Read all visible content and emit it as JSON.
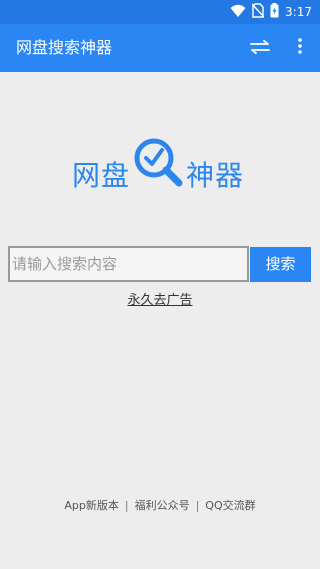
{
  "status_bar": {
    "time": "3:17",
    "icons": [
      "wifi-icon",
      "no-sim-icon",
      "battery-charging-icon"
    ]
  },
  "app_bar": {
    "title": "网盘搜索神器",
    "actions": [
      "swap-icon",
      "more-vert-icon"
    ]
  },
  "logo": {
    "left_text": "网盘",
    "right_text": "神器",
    "icon": "magnifier-check-icon"
  },
  "search": {
    "placeholder": "请输入搜索内容",
    "value": "",
    "button_label": "搜索"
  },
  "remove_ads_link": "永久去广告",
  "footer": {
    "links": [
      "App新版本",
      "福利公众号",
      "QQ交流群"
    ],
    "separator": "|"
  },
  "colors": {
    "status_bar": "#2478e4",
    "app_bar": "#2a86f3",
    "accent": "#2c86ee",
    "background": "#ededed"
  }
}
